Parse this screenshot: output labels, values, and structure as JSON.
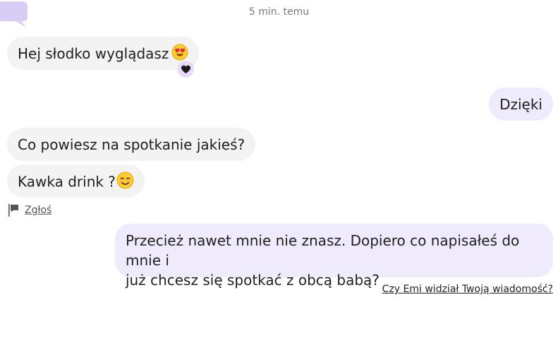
{
  "timestamp": "5 min. temu",
  "messages": [
    {
      "text": "Hej słodko wyglądasz",
      "emoji": "heart-eyes-emoji"
    },
    {
      "text": "Dzięki"
    },
    {
      "text": "Co powiesz na spotkanie jakieś?"
    },
    {
      "text": "Kawka drink ?",
      "emoji": "smiling-emoji"
    },
    {
      "line1": "Przecież nawet mnie nie znasz. Dopiero co napisałeś do mnie i",
      "line2": "już chcesz się spotkać z obcą babą?"
    }
  ],
  "reaction": {
    "icon": "heart-icon",
    "color": "#1a1a1a",
    "bg": "#e6dcfa"
  },
  "report": {
    "label": "Zgłoś",
    "icon": "flag-icon"
  },
  "seen_link": "Czy Emi widział Twoją wiadomość?",
  "colors": {
    "incoming_bubble": "#f3f3f3",
    "outgoing_bubble": "#efeafc",
    "accent": "#d9ccf5"
  }
}
